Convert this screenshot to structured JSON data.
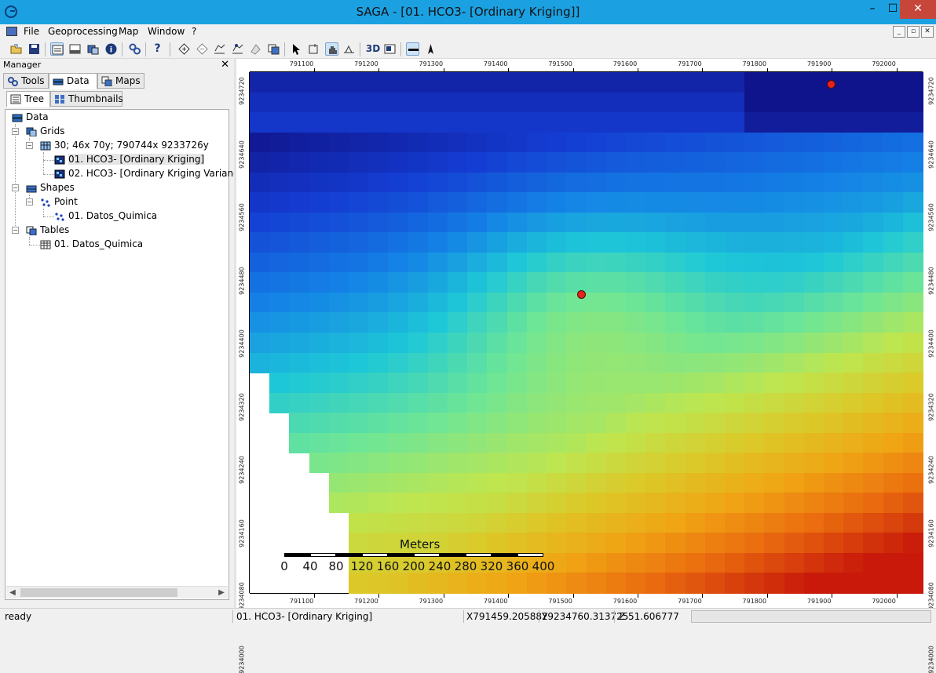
{
  "window": {
    "title": "SAGA - [01. HCO3- [Ordinary Kriging]]",
    "min_glyph": "–",
    "max_glyph": "☐",
    "close_glyph": "✕"
  },
  "menu": {
    "items": [
      "File",
      "Geoprocessing",
      "Map",
      "Window",
      "?"
    ],
    "mdi_buttons": [
      "_",
      "▫",
      "✕"
    ]
  },
  "toolbar": {
    "icons": [
      "open-icon",
      "save-icon",
      "show-workspace-icon",
      "show-messages-icon",
      "show-data-icon",
      "info-icon",
      "tools-icon",
      "help-icon",
      "add-shape-icon",
      "del-shape-icon",
      "edit-shape-icon",
      "move-shape-icon",
      "remove-shape-icon",
      "layers-icon",
      "select-icon",
      "zoom-icon",
      "pan-icon",
      "measure-icon",
      "3d-view-icon",
      "layout-icon",
      "scalebar-icon",
      "north-arrow-icon"
    ],
    "label_3d": "3D"
  },
  "manager": {
    "title": "Manager",
    "close": "✕",
    "tabs": [
      "Tools",
      "Data",
      "Maps"
    ],
    "subtabs": [
      "Tree",
      "Thumbnails"
    ],
    "tree": {
      "root": "Data",
      "grids": "Grids",
      "grid_system": "30; 46x 70y; 790744x 9233726y",
      "grid1": "01. HCO3- [Ordinary Kriging]",
      "grid2": "02. HCO3- [Ordinary Kriging Variance]",
      "shapes": "Shapes",
      "point": "Point",
      "shape1": "01. Datos_Quimica",
      "tables": "Tables",
      "table1": "01. Datos_Quimica"
    }
  },
  "map": {
    "x_ticks": [
      "791100",
      "791200",
      "791300",
      "791400",
      "791500",
      "791600",
      "791700",
      "791800",
      "791900",
      "792000"
    ],
    "y_ticks": [
      "9234720",
      "9234640",
      "9234560",
      "9234480",
      "9234400",
      "9234320",
      "9234240",
      "9234160",
      "9234080",
      "9234000"
    ],
    "scalebar": {
      "title": "Meters",
      "labels": [
        "0",
        "40",
        "80",
        "120",
        "160",
        "200",
        "240",
        "280",
        "320",
        "360",
        "400"
      ]
    }
  },
  "status": {
    "left": "ready",
    "layer": "01. HCO3- [Ordinary Kriging]",
    "x": "X791459.205882",
    "y": "Y9234760.313725",
    "z": "Z 51.606777"
  },
  "colors": {
    "titlebar": "#1ba1e2",
    "close": "#c7463a",
    "point": "#e8221a"
  }
}
